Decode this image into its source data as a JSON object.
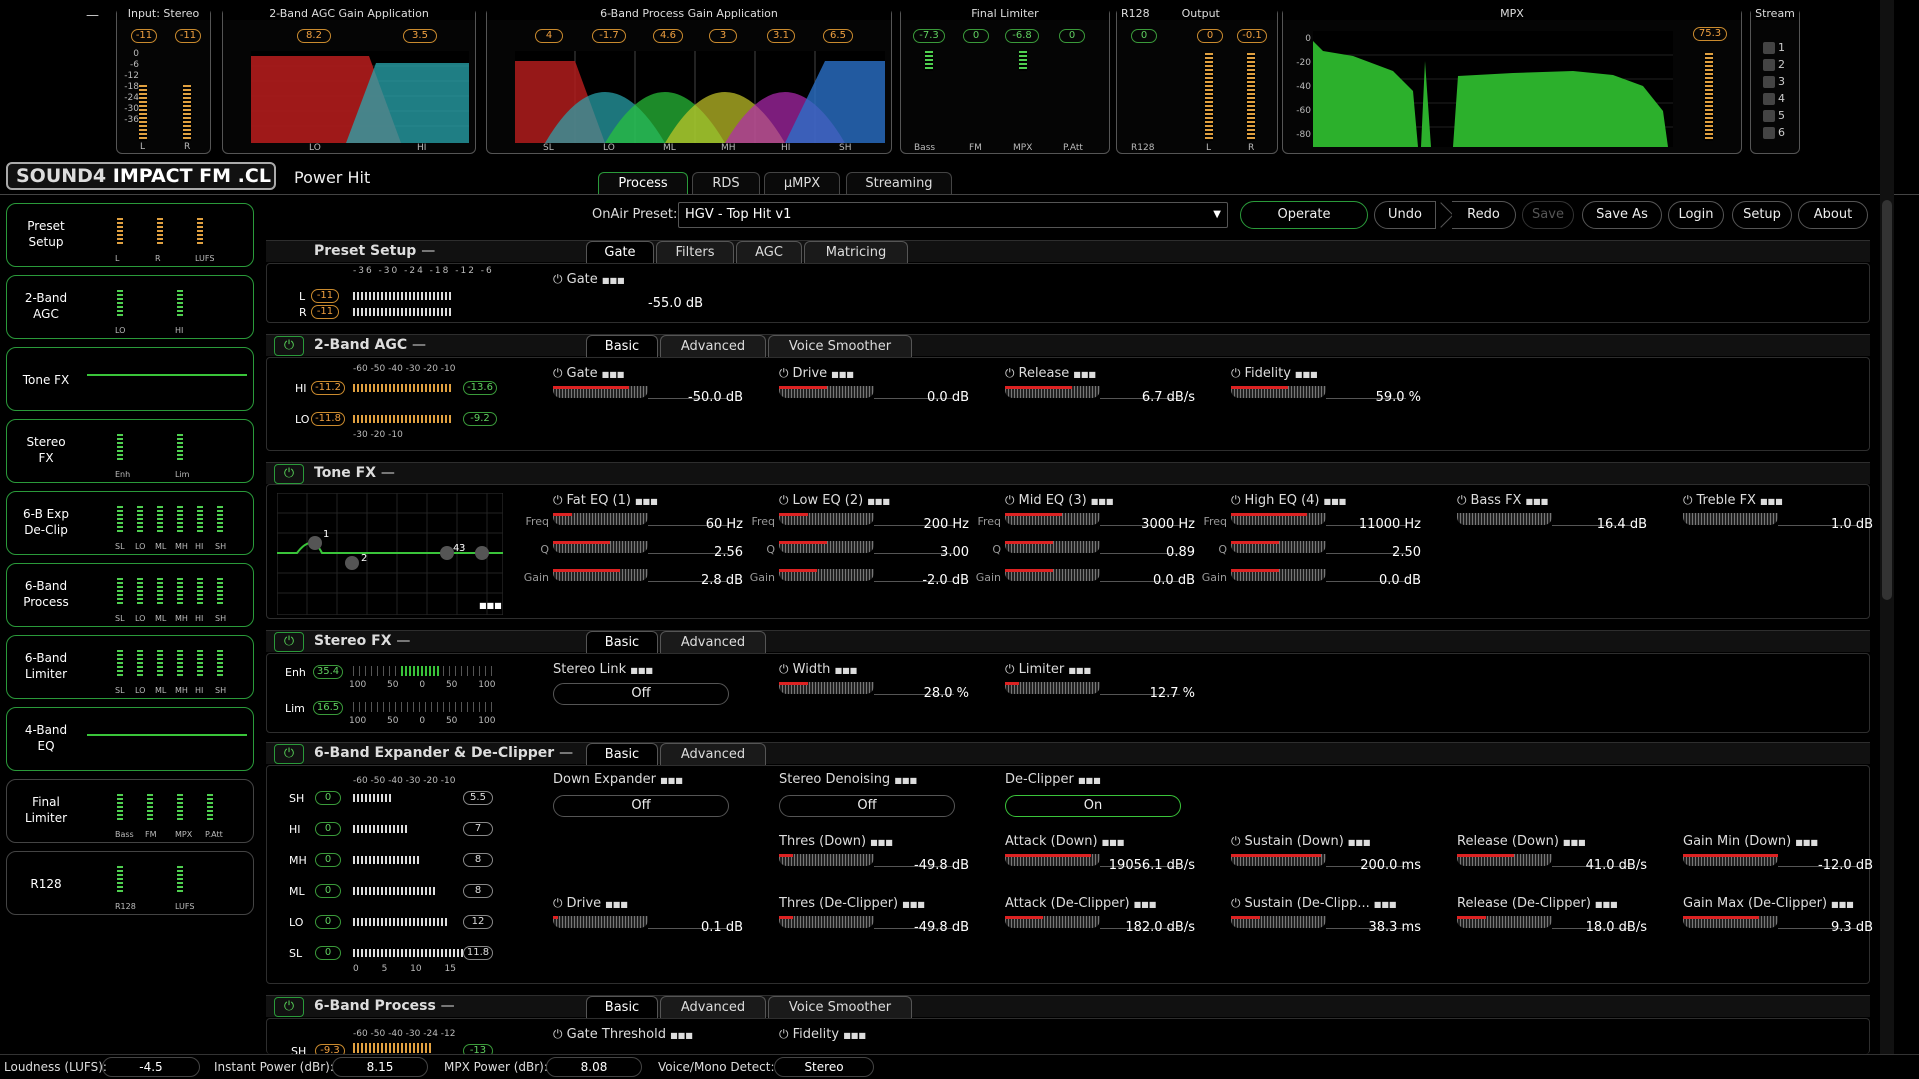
{
  "top": {
    "minimize": "—",
    "input_title": "Input: Stereo",
    "input_l": "-11",
    "input_r": "-11",
    "input_labels": [
      "L",
      "R"
    ],
    "agc_title": "2-Band AGC Gain Application",
    "agc_vals": [
      "8.2",
      "3.5"
    ],
    "agc_bands": [
      "LO",
      "HI"
    ],
    "proc_title": "6-Band Process Gain Application",
    "proc_vals": [
      "4",
      "-1.7",
      "4.6",
      "3",
      "3.1",
      "6.5"
    ],
    "proc_bands": [
      "SL",
      "LO",
      "ML",
      "MH",
      "HI",
      "SH"
    ],
    "lim_title": "Final Limiter",
    "lim_vals": [
      "-7.3",
      "0",
      "-6.8",
      "0"
    ],
    "lim_labels": [
      "Bass",
      "FM",
      "MPX",
      "P.Att"
    ],
    "r128_title": "R128",
    "r128_val": "0",
    "r128_label": "R128",
    "output_title": "Output",
    "output_vals": [
      "0",
      "-0.1"
    ],
    "output_labels": [
      "L",
      "R"
    ],
    "mpx_title": "MPX",
    "mpx_val": "75.3",
    "mpx_scale": [
      "0",
      "-20",
      "-40",
      "-60",
      "-80"
    ],
    "stream_title": "Stream",
    "stream_items": [
      "1",
      "2",
      "3",
      "4",
      "5",
      "6"
    ],
    "db_scale": [
      "0",
      "-6",
      "-12",
      "-18",
      "-24",
      "-30",
      "-36"
    ]
  },
  "brand": {
    "logo": "SOUND4",
    "station": "IMPACT FM .CL",
    "preset_name": "Power Hit"
  },
  "main_tabs": [
    {
      "label": "Process",
      "active": true
    },
    {
      "label": "RDS"
    },
    {
      "label": "µMPX"
    },
    {
      "label": "Streaming"
    }
  ],
  "toolbar": {
    "onair_label": "OnAir Preset:",
    "preset_value": "HGV - Top Hit v1",
    "operate": "Operate",
    "undo": "Undo",
    "redo": "Redo",
    "save": "Save",
    "save_as": "Save As",
    "login": "Login",
    "setup": "Setup",
    "about": "About"
  },
  "sidebar": [
    {
      "label": "Preset\nSetup",
      "sub": [
        "L",
        "R",
        "LUFS"
      ]
    },
    {
      "label": "2-Band\nAGC",
      "sub": [
        "LO",
        "HI"
      ]
    },
    {
      "label": "Tone FX",
      "sub": []
    },
    {
      "label": "Stereo\nFX",
      "sub": [
        "Enh",
        "Lim"
      ]
    },
    {
      "label": "6-B Exp\nDe-Clip",
      "sub": [
        "SL",
        "LO",
        "ML",
        "MH",
        "HI",
        "SH"
      ]
    },
    {
      "label": "6-Band\nProcess",
      "sub": [
        "SL",
        "LO",
        "ML",
        "MH",
        "HI",
        "SH"
      ]
    },
    {
      "label": "6-Band\nLimiter",
      "sub": [
        "SL",
        "LO",
        "ML",
        "MH",
        "HI",
        "SH"
      ]
    },
    {
      "label": "4-Band\nEQ",
      "sub": []
    },
    {
      "label": "Final\nLimiter",
      "sub": [
        "Bass",
        "FM",
        "MPX",
        "P.Att"
      ]
    },
    {
      "label": "R128",
      "sub": [
        "R128",
        "LUFS"
      ]
    }
  ],
  "preset_setup": {
    "title": "Preset Setup",
    "collapse": "—",
    "tabs": [
      "Gate",
      "Filters",
      "AGC",
      "Matricing"
    ],
    "rows": [
      {
        "label": "L",
        "value": "-11"
      },
      {
        "label": "R",
        "value": "-11"
      }
    ],
    "scale": [
      "-36",
      "-30",
      "-24",
      "-18",
      "-12",
      "-6"
    ],
    "gate_label": "Gate",
    "gate_value": "-55.0 dB"
  },
  "agc": {
    "title": "2-Band AGC",
    "collapse": "—",
    "tabs": [
      "Basic",
      "Advanced",
      "Voice Smoother"
    ],
    "rows": [
      {
        "label": "HI",
        "in": "-11.2",
        "out": "-13.6"
      },
      {
        "label": "LO",
        "in": "-11.8",
        "out": "-9.2"
      }
    ],
    "scale": [
      "-60",
      "-50",
      "-40",
      "-30",
      "-20",
      "-10"
    ],
    "scale2": [
      "-30",
      "-20",
      "-10"
    ],
    "knobs": [
      {
        "label": "Gate",
        "value": "-50.0 dB"
      },
      {
        "label": "Drive",
        "value": "0.0 dB"
      },
      {
        "label": "Release",
        "value": "6.7 dB/s"
      },
      {
        "label": "Fidelity",
        "value": "59.0 %"
      }
    ]
  },
  "tone": {
    "title": "Tone FX",
    "collapse": "—",
    "nodes": [
      "1",
      "2",
      "4",
      "3"
    ],
    "more": "■■■",
    "eq": [
      {
        "title": "Fat EQ (1)",
        "freq": "60 Hz",
        "q": "2.56",
        "gain": "2.8 dB"
      },
      {
        "title": "Low EQ (2)",
        "freq": "200 Hz",
        "q": "3.00",
        "gain": "-2.0 dB"
      },
      {
        "title": "Mid EQ (3)",
        "freq": "3000 Hz",
        "q": "0.89",
        "gain": "0.0 dB"
      },
      {
        "title": "High EQ (4)",
        "freq": "11000 Hz",
        "q": "2.50",
        "gain": "0.0 dB"
      }
    ],
    "freq_lbl": "Freq",
    "q_lbl": "Q",
    "gain_lbl": "Gain",
    "bass_fx": {
      "label": "Bass FX",
      "value": "16.4 dB"
    },
    "treble_fx": {
      "label": "Treble FX",
      "value": "1.0 dB"
    }
  },
  "stereo": {
    "title": "Stereo FX",
    "collapse": "—",
    "tabs": [
      "Basic",
      "Advanced"
    ],
    "rows": [
      {
        "label": "Enh",
        "value": "35.4"
      },
      {
        "label": "Lim",
        "value": "16.5"
      }
    ],
    "scale": [
      "100",
      "50",
      "0",
      "50",
      "100"
    ],
    "link_label": "Stereo Link",
    "link_value": "Off",
    "width": {
      "label": "Width",
      "value": "28.0 %"
    },
    "limiter": {
      "label": "Limiter",
      "value": "12.7 %"
    }
  },
  "expander": {
    "title": "6-Band Expander & De-Clipper",
    "collapse": "—",
    "tabs": [
      "Basic",
      "Advanced"
    ],
    "scale": [
      "-60",
      "-50",
      "-40",
      "-30",
      "-20",
      "-10"
    ],
    "scale_bottom": [
      "0",
      "5",
      "10",
      "15"
    ],
    "rows": [
      {
        "label": "SH",
        "in": "0",
        "out": "5.5"
      },
      {
        "label": "HI",
        "in": "0",
        "out": "7"
      },
      {
        "label": "MH",
        "in": "0",
        "out": "8"
      },
      {
        "label": "ML",
        "in": "0",
        "out": "8"
      },
      {
        "label": "LO",
        "in": "0",
        "out": "12"
      },
      {
        "label": "SL",
        "in": "0",
        "out": "11.8"
      }
    ],
    "down_expander": {
      "label": "Down Expander",
      "value": "Off"
    },
    "stereo_denoise": {
      "label": "Stereo Denoising",
      "value": "Off"
    },
    "declipper": {
      "label": "De-Clipper",
      "value": "On"
    },
    "knobs_row1": [
      {
        "label": "Thres (Down)",
        "value": "-49.8 dB"
      },
      {
        "label": "Attack (Down)",
        "value": "19056.1 dB/s"
      },
      {
        "label": "Sustain (Down)",
        "value": "200.0 ms"
      },
      {
        "label": "Release (Down)",
        "value": "41.0 dB/s"
      },
      {
        "label": "Gain Min (Down)",
        "value": "-12.0 dB"
      }
    ],
    "knobs_row2": [
      {
        "label": "Drive",
        "value": "0.1 dB"
      },
      {
        "label": "Thres (De-Clipper)",
        "value": "-49.8 dB"
      },
      {
        "label": "Attack (De-Clipper)",
        "value": "182.0 dB/s"
      },
      {
        "label": "Sustain (De-Clipp...",
        "value": "38.3 ms"
      },
      {
        "label": "Release (De-Clipper)",
        "value": "18.0 dB/s"
      },
      {
        "label": "Gain Max (De-Clipper)",
        "value": "9.3 dB"
      }
    ]
  },
  "process": {
    "title": "6-Band Process",
    "collapse": "—",
    "tabs": [
      "Basic",
      "Advanced",
      "Voice Smoother"
    ],
    "row": {
      "label": "SH",
      "in": "-9.3",
      "out": "-13"
    },
    "scale": [
      "-60",
      "-50",
      "-40",
      "-30",
      "-24",
      "-12"
    ],
    "gate_threshold": "Gate Threshold",
    "fidelity": "Fidelity"
  },
  "status": {
    "loudness_label": "Loudness (LUFS):",
    "loudness": "-4.5",
    "instant_label": "Instant Power (dBr):",
    "instant": "8.15",
    "mpx_label": "MPX Power (dBr):",
    "mpx": "8.08",
    "voice_label": "Voice/Mono Detect:",
    "voice": "Stereo"
  },
  "dots": "■■■",
  "power_icon": "⏻"
}
